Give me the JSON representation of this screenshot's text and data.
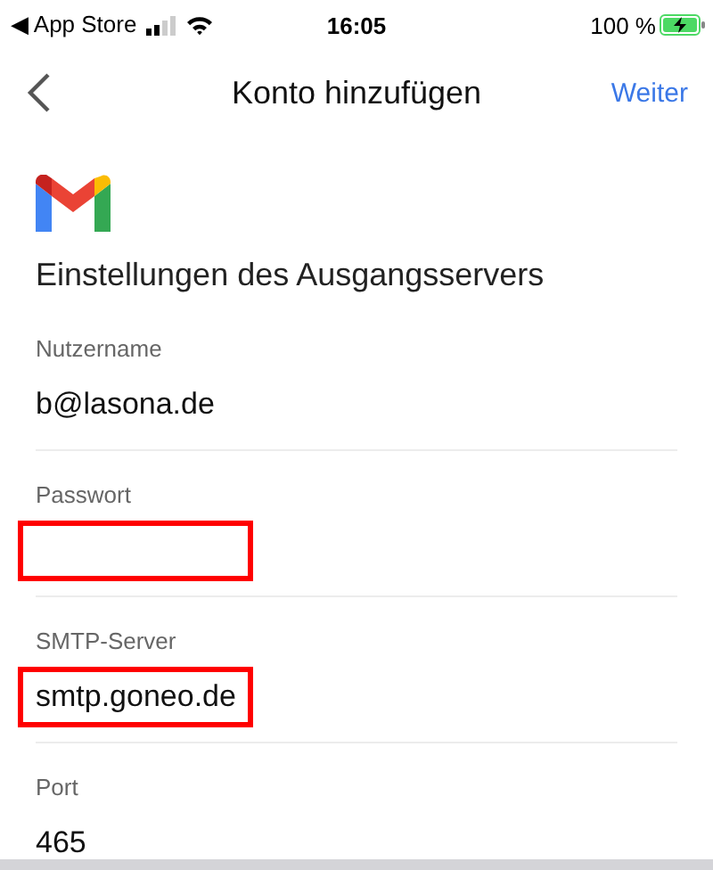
{
  "status_bar": {
    "back_app": "◀ App Store",
    "time": "16:05",
    "battery": "100 %",
    "charging": true
  },
  "nav": {
    "title": "Konto hinzufügen",
    "action": "Weiter"
  },
  "heading": "Einstellungen des Ausgangsservers",
  "fields": [
    {
      "label": "Nutzername",
      "value": "b@lasona.de",
      "highlighted": false
    },
    {
      "label": "Passwort",
      "highlighted": true
    },
    {
      "label": "SMTP-Server",
      "value": "smtp.goneo.de",
      "highlighted": true
    },
    {
      "label": "Port",
      "value": "465",
      "highlighted": false
    }
  ]
}
